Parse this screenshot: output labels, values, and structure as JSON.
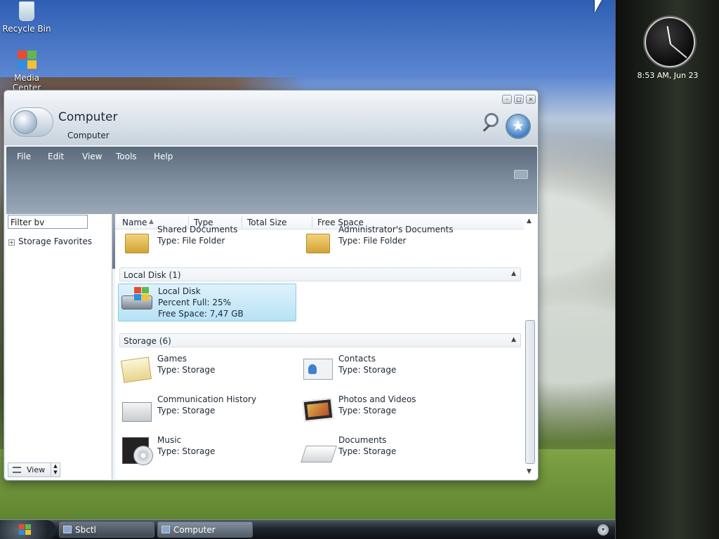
{
  "desktop": {
    "icons": [
      {
        "label": "Recycle Bin",
        "icon": "recycle-bin-icon"
      },
      {
        "label": "Media Center",
        "icon": "media-center-icon"
      }
    ]
  },
  "gadgets": {
    "clock_text": "8:53 AM, Jun 23"
  },
  "window": {
    "title": "Computer",
    "subtitle": "Computer",
    "menu": [
      "File",
      "Edit",
      "View",
      "Tools",
      "Help"
    ],
    "filter_value": "Filter bv",
    "tree_item": "Storage Favorites",
    "view_button": "View",
    "columns": [
      "Name",
      "Type",
      "Total Size",
      "Free Space"
    ],
    "folders": [
      {
        "name": "Shared Documents",
        "type": "Type: File Folder"
      },
      {
        "name": "Administrator's Documents",
        "type": "Type: File Folder"
      }
    ],
    "groups": {
      "local_disk": "Local Disk (1)",
      "storage": "Storage (6)"
    },
    "local_disk": {
      "name": "Local Disk",
      "percent": "Percent Full: 25%",
      "free": "Free Space: 7,47 GB"
    },
    "storage_items": [
      {
        "name": "Games",
        "type": "Type: Storage",
        "icon": "games-icon"
      },
      {
        "name": "Contacts",
        "type": "Type: Storage",
        "icon": "contacts-icon"
      },
      {
        "name": "Communication History",
        "type": "Type: Storage",
        "icon": "mail-icon"
      },
      {
        "name": "Photos and Videos",
        "type": "Type: Storage",
        "icon": "photos-icon"
      },
      {
        "name": "Music",
        "type": "Type: Storage",
        "icon": "music-icon"
      },
      {
        "name": "Documents",
        "type": "Type: Storage",
        "icon": "documents-icon"
      }
    ]
  },
  "taskbar": {
    "buttons": [
      {
        "label": "Sbctl"
      },
      {
        "label": "Computer"
      }
    ]
  }
}
